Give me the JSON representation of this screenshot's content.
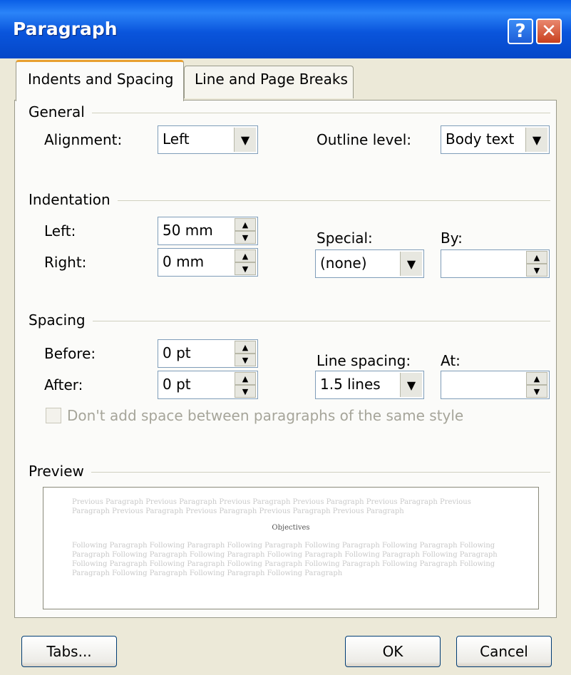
{
  "window": {
    "title": "Paragraph",
    "help_glyph": "?",
    "close_glyph": "✕"
  },
  "tabs": [
    {
      "label": "Indents and Spacing",
      "active": true
    },
    {
      "label": "Line and Page Breaks",
      "active": false
    }
  ],
  "general": {
    "heading": "General",
    "alignment_label": "Alignment:",
    "alignment_value": "Left",
    "outline_label": "Outline level:",
    "outline_value": "Body text"
  },
  "indentation": {
    "heading": "Indentation",
    "left_label": "Left:",
    "left_value": "50 mm",
    "right_label": "Right:",
    "right_value": "0 mm",
    "special_label": "Special:",
    "special_value": "(none)",
    "by_label": "By:",
    "by_value": ""
  },
  "spacing": {
    "heading": "Spacing",
    "before_label": "Before:",
    "before_value": "0 pt",
    "after_label": "After:",
    "after_value": "0 pt",
    "line_spacing_label": "Line spacing:",
    "line_spacing_value": "1.5 lines",
    "at_label": "At:",
    "at_value": "",
    "checkbox_label": "Don't add space between paragraphs of the same style",
    "checkbox_checked": false
  },
  "preview": {
    "heading": "Preview",
    "previous_text": "Previous Paragraph Previous Paragraph Previous Paragraph Previous Paragraph Previous Paragraph Previous Paragraph Previous Paragraph Previous Paragraph Previous Paragraph Previous Paragraph",
    "current_text": "Objectives",
    "following_text": "Following Paragraph Following Paragraph Following Paragraph Following Paragraph Following Paragraph Following Paragraph Following Paragraph Following Paragraph Following Paragraph Following Paragraph Following Paragraph Following Paragraph Following Paragraph Following Paragraph Following Paragraph Following Paragraph Following Paragraph Following Paragraph Following Paragraph Following Paragraph"
  },
  "buttons": {
    "tabs": "Tabs...",
    "ok": "OK",
    "cancel": "Cancel"
  },
  "colors": {
    "titlebar": "#0A55DC",
    "dialog_bg": "#ECE9D8",
    "active_tab_accent": "#E8A030"
  }
}
